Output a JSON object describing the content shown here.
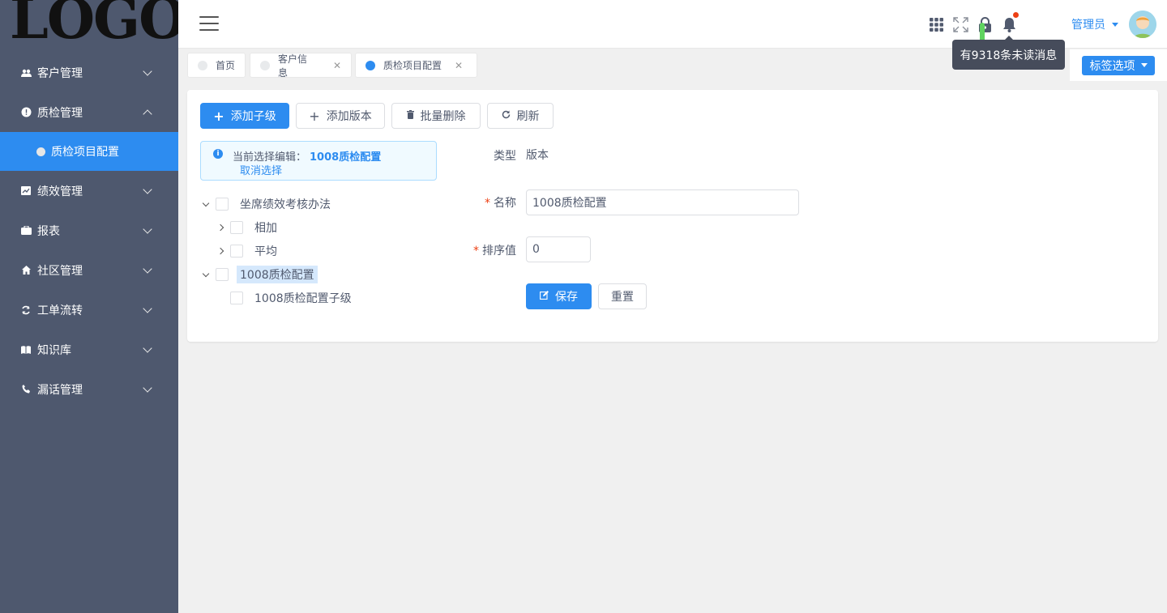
{
  "logo": "LOGO",
  "sidebar": {
    "items": [
      {
        "label": "客户管理",
        "icon": "users-icon"
      },
      {
        "label": "质检管理",
        "icon": "alert-circle-icon"
      },
      {
        "label": "绩效管理",
        "icon": "chart-icon"
      },
      {
        "label": "报表",
        "icon": "briefcase-icon"
      },
      {
        "label": "社区管理",
        "icon": "home-icon"
      },
      {
        "label": "工单流转",
        "icon": "refresh-icon"
      },
      {
        "label": "知识库",
        "icon": "book-icon"
      },
      {
        "label": "漏话管理",
        "icon": "phone-icon"
      }
    ],
    "active_sub": "质检项目配置"
  },
  "header": {
    "user": "管理员",
    "notifications_tooltip": "有9318条未读消息"
  },
  "tabs": [
    {
      "label": "首页",
      "closable": false,
      "active": false
    },
    {
      "label": "客户信息",
      "closable": true,
      "active": false
    },
    {
      "label": "质检项目配置",
      "closable": true,
      "active": true
    }
  ],
  "tag_options": "标签选项",
  "toolbar": {
    "add_child": "添加子级",
    "add_version": "添加版本",
    "batch_delete": "批量删除",
    "refresh": "刷新"
  },
  "alert": {
    "prefix": "当前选择编辑：",
    "selected": "1008质检配置",
    "cancel": "取消选择"
  },
  "tree": [
    {
      "label": "坐席绩效考核办法",
      "level": 0,
      "expanded": true
    },
    {
      "label": "相加",
      "level": 1,
      "expanded": false
    },
    {
      "label": "平均",
      "level": 1,
      "expanded": false
    },
    {
      "label": "1008质检配置",
      "level": 0,
      "expanded": true,
      "selected": true
    },
    {
      "label": "1008质检配置子级",
      "level": 1,
      "leaf": true
    }
  ],
  "form": {
    "type_label": "类型",
    "type_value": "版本",
    "name_label": "名称",
    "name_value": "1008质检配置",
    "sort_label": "排序值",
    "sort_value": "0",
    "save": "保存",
    "reset": "重置"
  },
  "colors": {
    "primary": "#2d8cf0",
    "sidebar": "#4e586e",
    "danger": "#ed4014"
  }
}
